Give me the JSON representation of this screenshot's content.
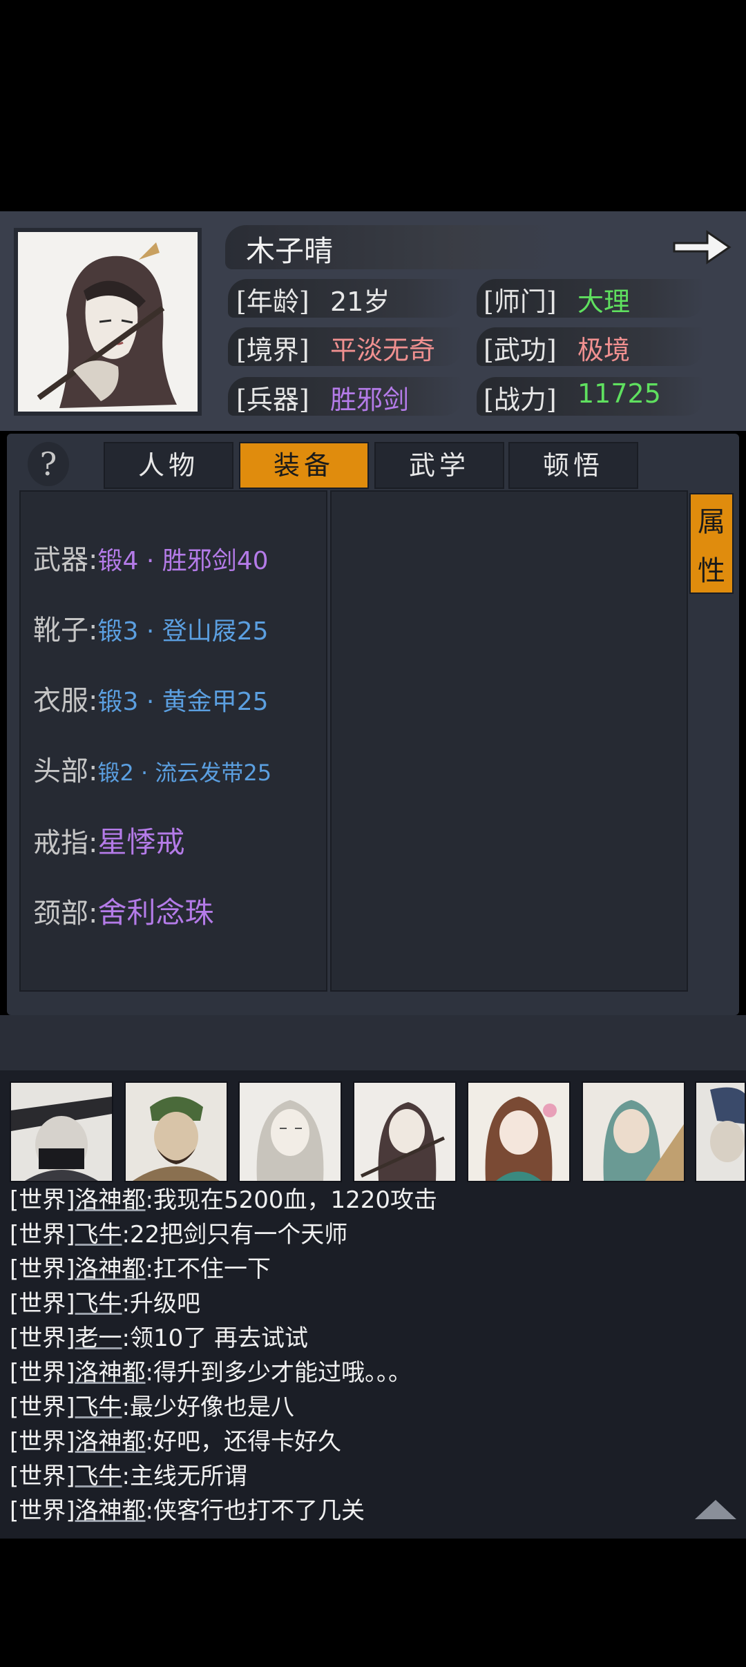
{
  "character": {
    "name": "木子晴",
    "stats": [
      {
        "label": "[年龄]",
        "value": "21岁",
        "color": "#e8e8e8"
      },
      {
        "label": "[师门]",
        "value": "大理",
        "color": "#5fe05f"
      },
      {
        "label": "[境界]",
        "value": "平淡无奇",
        "color": "#f09090"
      },
      {
        "label": "[武功]",
        "value": "极境",
        "color": "#f09090"
      },
      {
        "label": "[兵器]",
        "value": "胜邪剑",
        "color": "#b47be8"
      },
      {
        "label": "[战力]",
        "value": "11725",
        "color": "#5fe05f"
      }
    ]
  },
  "tabs": [
    {
      "label": "人物",
      "active": false
    },
    {
      "label": "装备",
      "active": true
    },
    {
      "label": "武学",
      "active": false
    },
    {
      "label": "顿悟",
      "active": false
    }
  ],
  "help_label": "?",
  "side_tab": {
    "chars": [
      "属",
      "性"
    ]
  },
  "equipment": [
    {
      "label": "武器:",
      "value": "锻4 · 胜邪剑40",
      "color": "#b47be8"
    },
    {
      "label": "靴子:",
      "value": "锻3 · 登山屐25",
      "color": "#5b9fe0"
    },
    {
      "label": "衣服:",
      "value": "锻3 · 黄金甲25",
      "color": "#5b9fe0"
    },
    {
      "label": "头部:",
      "value": "锻2 · 流云发带25",
      "color": "#5b9fe0"
    },
    {
      "label": "戒指:",
      "value": "星悸戒",
      "color": "#b47be8"
    },
    {
      "label": "颈部:",
      "value": "舍利念珠",
      "color": "#b47be8"
    }
  ],
  "roster_icons": [
    "masked-hero-portrait",
    "bearded-general-portrait",
    "white-haired-woman-portrait",
    "swordswoman-portrait",
    "flower-girl-portrait",
    "teal-haired-warrior-portrait",
    "armored-hero-portrait"
  ],
  "chat": [
    {
      "channel": "[世界]",
      "user": "洛神都",
      "message": ":我现在5200血，1220攻击"
    },
    {
      "channel": "[世界]",
      "user": "飞牛",
      "message": ":22把剑只有一个天师"
    },
    {
      "channel": "[世界]",
      "user": "洛神都",
      "message": ":扛不住一下"
    },
    {
      "channel": "[世界]",
      "user": "飞牛",
      "message": ":升级吧"
    },
    {
      "channel": "[世界]",
      "user": "老一",
      "message": ":领10了 再去试试"
    },
    {
      "channel": "[世界]",
      "user": "洛神都",
      "message": ":得升到多少才能过哦。。。"
    },
    {
      "channel": "[世界]",
      "user": "飞牛",
      "message": ":最少好像也是八"
    },
    {
      "channel": "[世界]",
      "user": "洛神都",
      "message": ":好吧，还得卡好久"
    },
    {
      "channel": "[世界]",
      "user": "飞牛",
      "message": ":主线无所谓"
    },
    {
      "channel": "[世界]",
      "user": "洛神都",
      "message": ":侠客行也打不了几关"
    }
  ]
}
